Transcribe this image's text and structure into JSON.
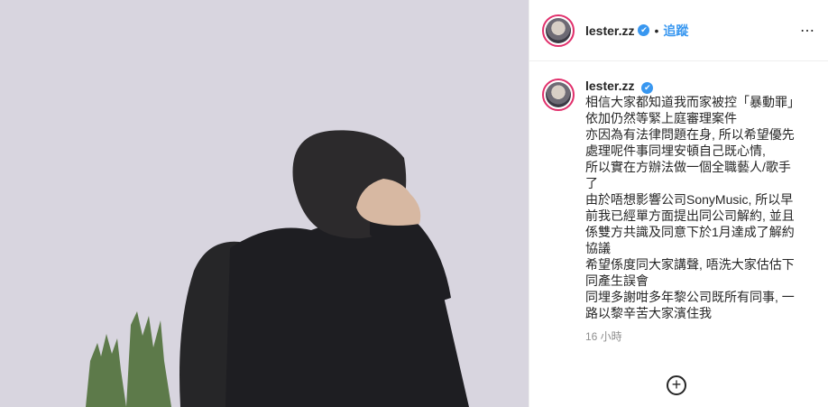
{
  "header": {
    "username": "lester.zz",
    "verified_glyph": "✔",
    "separator": "•",
    "follow_label": "追蹤",
    "more_label": "⋯"
  },
  "post": {
    "username": "lester.zz",
    "caption_lines": [
      "相信大家都知道我而家被控「暴動罪」",
      "依加仍然等緊上庭審理案件",
      "亦因為有法律問題在身, 所以希望優先",
      "處理呢件事同埋安頓自己既心情,",
      "所以實在方辦法做一個全職藝人/歌手",
      "了",
      "由於唔想影響公司SonyMusic, 所以早",
      "前我已經單方面提出同公司解約, 並且",
      "係雙方共識及同意下於1月達成了解約",
      "協議",
      "希望係度同大家講聲, 唔洗大家估估下",
      "同產生誤會",
      "同埋多謝咁多年黎公司既所有同事, 一",
      "路以黎辛苦大家濱住我"
    ],
    "time": "16 小時"
  },
  "add_button_label": "+",
  "colors": {
    "accent": "#3897f0",
    "ring": "#e1306c",
    "sky": "#d9d6e0"
  }
}
